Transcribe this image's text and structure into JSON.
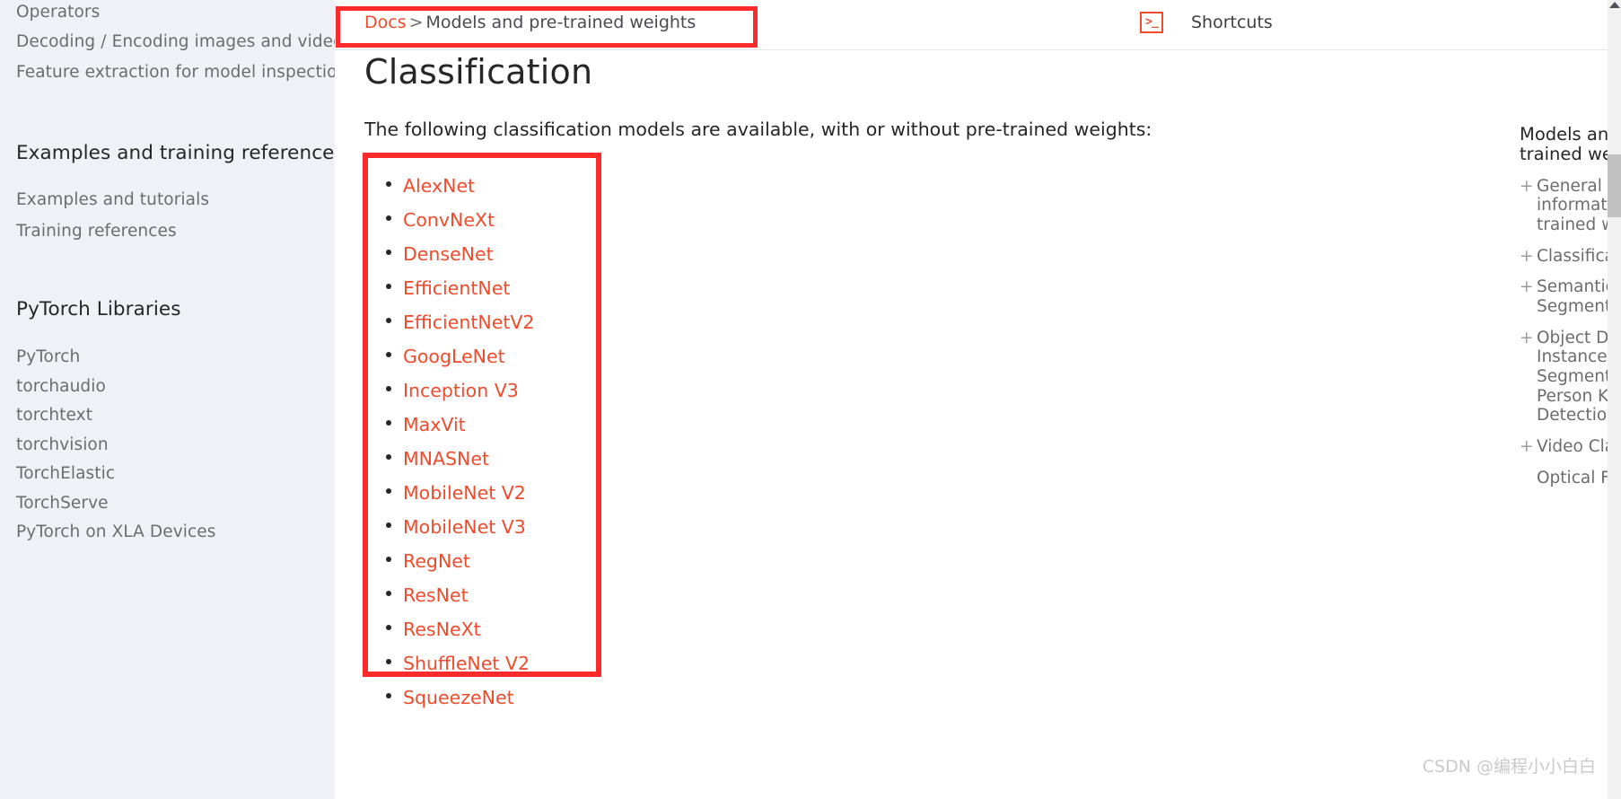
{
  "sidebar": {
    "items_top": [
      {
        "label": "Operators"
      },
      {
        "label": "Decoding / Encoding images and videos"
      },
      {
        "label": "Feature extraction for model inspection"
      }
    ],
    "section_examples": {
      "caption": "Examples and training references",
      "items": [
        {
          "label": "Examples and tutorials"
        },
        {
          "label": "Training references"
        }
      ]
    },
    "section_libraries": {
      "caption": "PyTorch Libraries",
      "items": [
        {
          "label": "PyTorch"
        },
        {
          "label": "torchaudio"
        },
        {
          "label": "torchtext"
        },
        {
          "label": "torchvision"
        },
        {
          "label": "TorchElastic"
        },
        {
          "label": "TorchServe"
        },
        {
          "label": "PyTorch on XLA Devices"
        }
      ]
    }
  },
  "header": {
    "breadcrumb": {
      "root": "Docs",
      "separator": ">",
      "current": "Models and pre-trained weights"
    },
    "shortcuts": {
      "icon": "terminal-icon",
      "icon_glyph": ">_",
      "label": "Shortcuts"
    }
  },
  "main": {
    "title": "Classification",
    "intro": "The following classification models are available, with or without pre-trained weights:",
    "models": [
      {
        "label": "AlexNet"
      },
      {
        "label": "ConvNeXt"
      },
      {
        "label": "DenseNet"
      },
      {
        "label": "EfficientNet"
      },
      {
        "label": "EfficientNetV2"
      },
      {
        "label": "GoogLeNet"
      },
      {
        "label": "Inception V3"
      },
      {
        "label": "MaxVit"
      },
      {
        "label": "MNASNet"
      },
      {
        "label": "MobileNet V2"
      },
      {
        "label": "MobileNet V3"
      },
      {
        "label": "RegNet"
      },
      {
        "label": "ResNet"
      },
      {
        "label": "ResNeXt"
      },
      {
        "label": "ShuffleNet V2"
      },
      {
        "label": "SqueezeNet"
      }
    ]
  },
  "toc": {
    "title": "Models and pre-trained weights",
    "items": [
      {
        "prefix": "+",
        "label": "General information on pre-trained weights"
      },
      {
        "prefix": "+",
        "label": "Classification"
      },
      {
        "prefix": "+",
        "label": "Semantic Segmentation"
      },
      {
        "prefix": "+",
        "label": "Object Detection, Instance Segmentation and Person Keypoint Detection"
      },
      {
        "prefix": "+",
        "label": "Video Classification"
      },
      {
        "prefix": "",
        "label": "Optical Flow"
      }
    ]
  },
  "watermark": {
    "text": "CSDN @编程小小白白"
  },
  "colors": {
    "accent": "#ee4c2c",
    "annotation": "#fc2b2b",
    "sidebar_bg": "#f0f1f6",
    "text": "#262626",
    "muted_text": "#6c6c6d"
  }
}
